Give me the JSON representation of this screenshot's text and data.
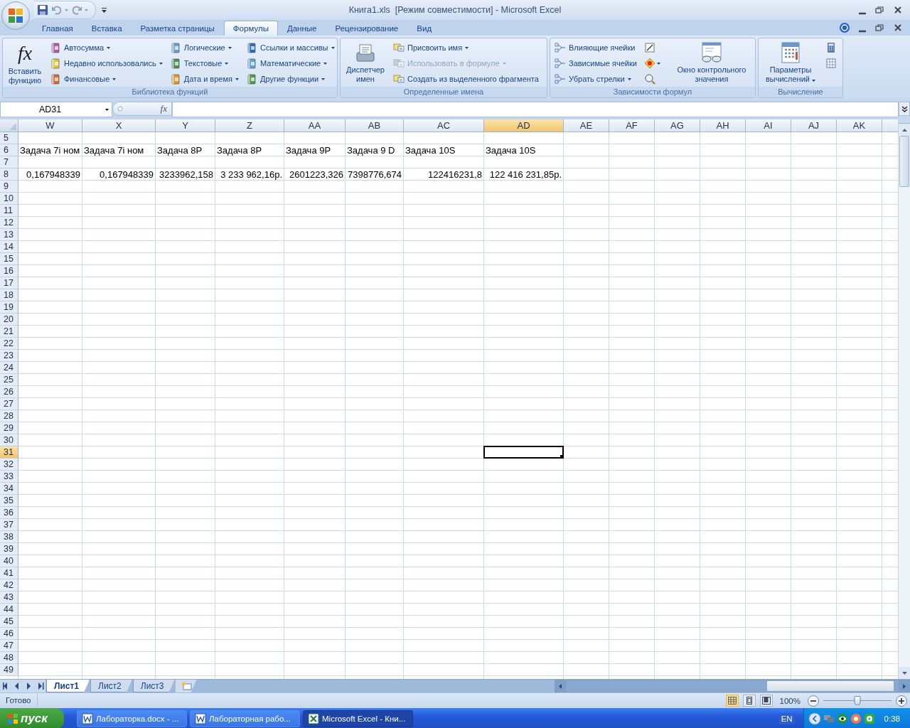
{
  "window": {
    "title": "Книга1.xls  [Режим совместимости] - Microsoft Excel"
  },
  "ribbon_tabs": [
    {
      "label": "Главная",
      "selected": false
    },
    {
      "label": "Вставка",
      "selected": false
    },
    {
      "label": "Разметка страницы",
      "selected": false
    },
    {
      "label": "Формулы",
      "selected": true
    },
    {
      "label": "Данные",
      "selected": false
    },
    {
      "label": "Рецензирование",
      "selected": false
    },
    {
      "label": "Вид",
      "selected": false
    }
  ],
  "ribbon_groups": [
    {
      "label": "Библиотека функций",
      "parts": [
        {
          "kind": "large",
          "icon_text": "fx",
          "label": "Вставить функцию",
          "dropdown": false
        },
        {
          "kind": "column",
          "items": [
            {
              "label": "Автосумма",
              "dropdown": true,
              "disabled": false
            },
            {
              "label": "Недавно использовались",
              "dropdown": true,
              "disabled": false
            },
            {
              "label": "Финансовые",
              "dropdown": true,
              "disabled": false
            }
          ]
        },
        {
          "kind": "column",
          "items": [
            {
              "label": "Логические",
              "dropdown": true,
              "disabled": false
            },
            {
              "label": "Текстовые",
              "dropdown": true,
              "disabled": false
            },
            {
              "label": "Дата и время",
              "dropdown": true,
              "disabled": false
            }
          ]
        },
        {
          "kind": "column",
          "items": [
            {
              "label": "Ссылки и массивы",
              "dropdown": true,
              "disabled": false
            },
            {
              "label": "Математические",
              "dropdown": true,
              "disabled": false
            },
            {
              "label": "Другие функции",
              "dropdown": true,
              "disabled": false
            }
          ]
        }
      ]
    },
    {
      "label": "Определенные имена",
      "parts": [
        {
          "kind": "large",
          "label": "Диспетчер имен",
          "dropdown": false
        },
        {
          "kind": "column",
          "items": [
            {
              "label": "Присвоить имя",
              "dropdown": true,
              "disabled": false
            },
            {
              "label": "Использовать в формуле",
              "dropdown": true,
              "disabled": true
            },
            {
              "label": "Создать из выделенного фрагмента",
              "dropdown": false,
              "disabled": false
            }
          ]
        }
      ]
    },
    {
      "label": "Зависимости формул",
      "parts": [
        {
          "kind": "column",
          "items": [
            {
              "label": "Влияющие ячейки",
              "dropdown": false,
              "disabled": false
            },
            {
              "label": "Зависимые ячейки",
              "dropdown": false,
              "disabled": false
            },
            {
              "label": "Убрать стрелки",
              "dropdown": true,
              "disabled": false
            }
          ]
        },
        {
          "kind": "icons",
          "items": [
            {
              "dropdown": false
            },
            {
              "dropdown": true
            },
            {
              "dropdown": false
            }
          ]
        },
        {
          "kind": "separator"
        },
        {
          "kind": "large",
          "label": "Окно контрольного значения",
          "dropdown": false
        }
      ]
    },
    {
      "label": "Вычисление",
      "parts": [
        {
          "kind": "large",
          "label": "Параметры вычислений",
          "dropdown": true
        },
        {
          "kind": "icons",
          "items": [
            {
              "dropdown": false
            },
            {
              "dropdown": false
            }
          ]
        }
      ]
    }
  ],
  "formula_bar": {
    "name_box": "AD31",
    "function_button": "fx"
  },
  "grid": {
    "columns": [
      {
        "label": "W",
        "selected": false
      },
      {
        "label": "X",
        "selected": false
      },
      {
        "label": "Y",
        "selected": false
      },
      {
        "label": "Z",
        "selected": false
      },
      {
        "label": "AA",
        "selected": false
      },
      {
        "label": "AB",
        "selected": false
      },
      {
        "label": "AC",
        "selected": false
      },
      {
        "label": "AD",
        "selected": true
      },
      {
        "label": "AE",
        "selected": false
      },
      {
        "label": "AF",
        "selected": false
      },
      {
        "label": "AG",
        "selected": false
      },
      {
        "label": "AH",
        "selected": false
      },
      {
        "label": "AI",
        "selected": false
      },
      {
        "label": "AJ",
        "selected": false
      },
      {
        "label": "AK",
        "selected": false
      }
    ],
    "rows": [
      {
        "header": "5",
        "selected": false
      },
      {
        "header": "6",
        "selected": false,
        "kind": "text",
        "cells": [
          "Задача 7i ном",
          "Задача 7i ном",
          "Задача 8P",
          "Задача 8P",
          "Задача 9P",
          "Задача 9 D",
          "Задача 10S",
          "Задача 10S"
        ]
      },
      {
        "header": "7",
        "selected": false
      },
      {
        "header": "8",
        "selected": false,
        "kind": "number",
        "cells": [
          "0,167948339",
          "0,167948339",
          "3233962,158",
          "3 233 962,16р.",
          "2601223,326",
          "7398776,674",
          "122416231,8",
          "122 416 231,85р."
        ]
      },
      {
        "header": "9",
        "selected": false
      },
      {
        "header": "10",
        "selected": false
      },
      {
        "header": "11",
        "selected": false
      },
      {
        "header": "12",
        "selected": false
      },
      {
        "header": "13",
        "selected": false
      },
      {
        "header": "14",
        "selected": false
      },
      {
        "header": "15",
        "selected": false
      },
      {
        "header": "16",
        "selected": false
      },
      {
        "header": "17",
        "selected": false
      },
      {
        "header": "18",
        "selected": false
      },
      {
        "header": "19",
        "selected": false
      },
      {
        "header": "20",
        "selected": false
      },
      {
        "header": "21",
        "selected": false
      },
      {
        "header": "22",
        "selected": false
      },
      {
        "header": "23",
        "selected": false
      },
      {
        "header": "24",
        "selected": false
      },
      {
        "header": "25",
        "selected": false
      },
      {
        "header": "26",
        "selected": false
      },
      {
        "header": "27",
        "selected": false
      },
      {
        "header": "28",
        "selected": false
      },
      {
        "header": "29",
        "selected": false
      },
      {
        "header": "30",
        "selected": false
      },
      {
        "header": "31",
        "selected": true
      },
      {
        "header": "32",
        "selected": false
      },
      {
        "header": "33",
        "selected": false
      },
      {
        "header": "34",
        "selected": false
      },
      {
        "header": "35",
        "selected": false
      },
      {
        "header": "36",
        "selected": false
      },
      {
        "header": "37",
        "selected": false
      },
      {
        "header": "38",
        "selected": false
      },
      {
        "header": "39",
        "selected": false
      },
      {
        "header": "40",
        "selected": false
      },
      {
        "header": "41",
        "selected": false
      },
      {
        "header": "42",
        "selected": false
      },
      {
        "header": "43",
        "selected": false
      },
      {
        "header": "44",
        "selected": false
      },
      {
        "header": "45",
        "selected": false
      },
      {
        "header": "46",
        "selected": false
      },
      {
        "header": "47",
        "selected": false
      },
      {
        "header": "48",
        "selected": false
      },
      {
        "header": "49",
        "selected": false
      }
    ]
  },
  "sheet_tabs": [
    {
      "label": "Лист1",
      "selected": true
    },
    {
      "label": "Лист2",
      "selected": false
    },
    {
      "label": "Лист3",
      "selected": false
    }
  ],
  "status_bar": {
    "text": "Готово",
    "views": [
      {
        "selected": true
      },
      {
        "selected": false
      },
      {
        "selected": false
      }
    ],
    "zoom": {
      "label": "100%",
      "level": 0.5
    }
  },
  "taskbar": {
    "start": "пуск",
    "tasks": [
      {
        "label": "Лабораторка.docx - ...",
        "kind": "word",
        "selected": false
      },
      {
        "label": "Лабораторная рабо...",
        "kind": "word",
        "selected": false
      },
      {
        "label": "Microsoft Excel - Кни...",
        "kind": "excel",
        "selected": true
      }
    ],
    "language": "EN",
    "clock": "0:38"
  }
}
